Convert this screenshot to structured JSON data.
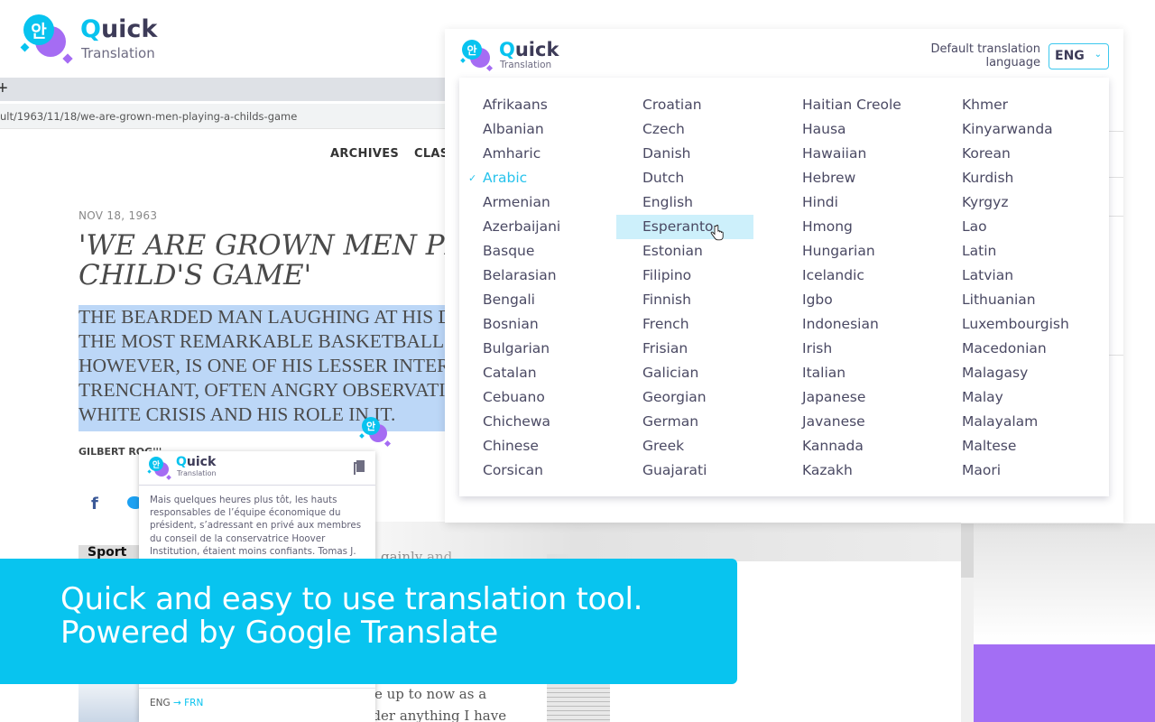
{
  "brand": {
    "name_first": "Q",
    "name_rest": "uick",
    "subtitle": "Translation",
    "logo_glyph": "안",
    "colors": {
      "cyan": "#08c3ef",
      "purple": "#a56cf3",
      "dark": "#3d3b58"
    }
  },
  "browser": {
    "new_tab_icon": "+",
    "url": "ult/1963/11/18/we-are-grown-men-playing-a-childs-game"
  },
  "article": {
    "nav": [
      "ARCHIVES",
      "CLAS"
    ],
    "date": "NOV 18, 1963",
    "title_lines": [
      "'WE ARE GROWN MEN PLA",
      "CHILD'S GAME'"
    ],
    "deck_lines": [
      "THE BEARDED MAN LAUGHING AT HIS DAUG",
      "THE MOST REMARKABLE BASKETBALL PLAY",
      "HOWEVER, IS ONE OF HIS LESSER INTEREST",
      "TRENCHANT, OFTEN ANGRY OBSERVATIONS",
      "WHITE CRISIS AND HIS ROLE IN IT."
    ],
    "author": "GILBERT ROG'''",
    "social": {
      "facebook": "f"
    },
    "section_label": "Sport",
    "body_fragments": [
      "gainly and",
      "e up to now as a",
      "waste.  I don't consider anything I have"
    ]
  },
  "translation_popup": {
    "text": "Mais quelques heures plus tôt, les hauts responsables de l’équipe économique du président, s’adressant en privé aux membres du conseil de la conservatrice Hoover Institution, étaient moins confiants. Tomas J. Philipson, conseiller économique principal du",
    "source_lang": "ENG",
    "arrow": "→",
    "target_lang": "FRN"
  },
  "options_panel": {
    "default_language_label_line1": "Default translation",
    "default_language_label_line2": "language",
    "selected_code": "ENG",
    "selected_language": "Arabic",
    "hovered_language": "Esperanto",
    "columns": [
      [
        "Afrikaans",
        "Albanian",
        "Amharic",
        "Arabic",
        "Armenian",
        "Azerbaijani",
        "Basque",
        "Belarasian",
        "Bengali",
        "Bosnian",
        "Bulgarian",
        "Catalan",
        "Cebuano",
        "Chichewa",
        "Chinese",
        "Corsican"
      ],
      [
        "Croatian",
        "Czech",
        "Danish",
        "Dutch",
        "English",
        "Esperanto",
        "Estonian",
        "Filipino",
        "Finnish",
        "French",
        "Frisian",
        "Galician",
        "Georgian",
        "German",
        "Greek",
        "Guajarati"
      ],
      [
        "Haitian Creole",
        "Hausa",
        "Hawaiian",
        "Hebrew",
        "Hindi",
        "Hmong",
        "Hungarian",
        "Icelandic",
        "Igbo",
        "Indonesian",
        "Irish",
        "Italian",
        "Japanese",
        "Javanese",
        "Kannada",
        "Kazakh"
      ],
      [
        "Khmer",
        "Kinyarwanda",
        "Korean",
        "Kurdish",
        "Kyrgyz",
        "Lao",
        "Latin",
        "Latvian",
        "Lithuanian",
        "Luxembourgish",
        "Macedonian",
        "Malagasy",
        "Malay",
        "Malayalam",
        "Maltese",
        "Maori"
      ]
    ]
  },
  "banner": {
    "line1": "Quick and easy to use translation tool.",
    "line2": "Powered by Google Translate",
    "color": "#08c4ef"
  }
}
